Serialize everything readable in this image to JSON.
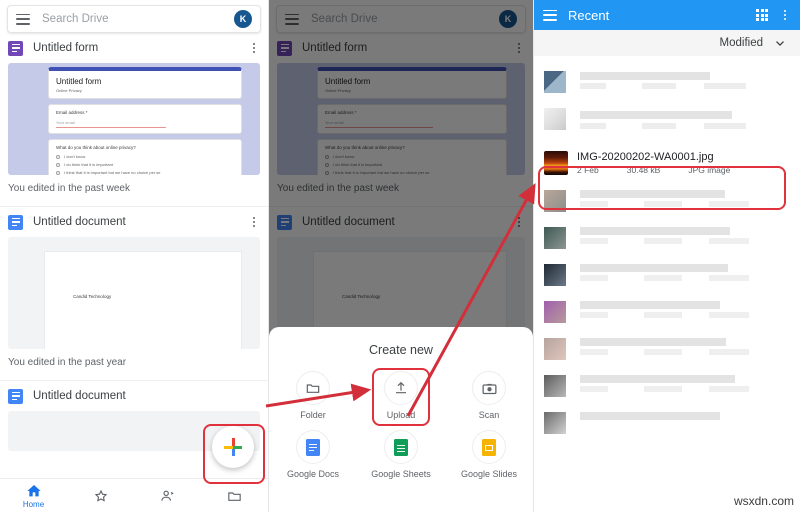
{
  "app": {
    "search_placeholder": "Search Drive",
    "avatar_initial": "K",
    "accent_blue": "#2196f3",
    "annotation_red": "#e0323c"
  },
  "left_panel": {
    "cards": [
      {
        "title": "Untitled form",
        "type": "forms",
        "meta": "You edited in the past week",
        "preview": {
          "heading": "Untitled form",
          "subheading": "Online Privacy",
          "field_label": "Email address *",
          "field_placeholder": "Your email",
          "question": "What do you think about online privacy?",
          "options": [
            "I don't know",
            "I do think that it is important",
            "I think that it is important but we have no choice per se"
          ]
        }
      },
      {
        "title": "Untitled document",
        "type": "docs",
        "meta": "You edited in the past year",
        "preview": {
          "body_text": "Candid Technology"
        }
      },
      {
        "title": "Untitled document",
        "type": "docs",
        "meta": "",
        "preview": {
          "body_text": ""
        }
      }
    ],
    "bottom_nav": [
      {
        "label": "Home",
        "icon": "home-icon",
        "active": true
      },
      {
        "label": "",
        "icon": "star-icon",
        "active": false
      },
      {
        "label": "",
        "icon": "shared-people-icon",
        "active": false
      },
      {
        "label": "",
        "icon": "folder-icon",
        "active": false
      }
    ],
    "fab": {
      "icon": "plus-icon"
    }
  },
  "mid_panel": {
    "sheet": {
      "title": "Create new",
      "items": [
        {
          "label": "Folder",
          "icon": "folder-icon"
        },
        {
          "label": "Upload",
          "icon": "upload-icon"
        },
        {
          "label": "Scan",
          "icon": "camera-scan-icon"
        },
        {
          "label": "Google Docs",
          "icon": "google-docs-icon"
        },
        {
          "label": "Google Sheets",
          "icon": "google-sheets-icon"
        },
        {
          "label": "Google Slides",
          "icon": "google-slides-icon"
        }
      ]
    }
  },
  "right_panel": {
    "appbar": {
      "title": "Recent",
      "menu_icon": "hamburger-icon",
      "grid_icon": "grid-view-icon",
      "overflow_icon": "more-vert-icon"
    },
    "sort": {
      "label": "Modified",
      "icon": "chevron-down-icon"
    },
    "highlighted_file": {
      "name": "IMG-20200202-WA0001.jpg",
      "date": "2 Feb",
      "size": "30.48 kB",
      "kind": "JPG image"
    },
    "blurred_rows_count": 9
  },
  "watermark": "wsxdn.com"
}
